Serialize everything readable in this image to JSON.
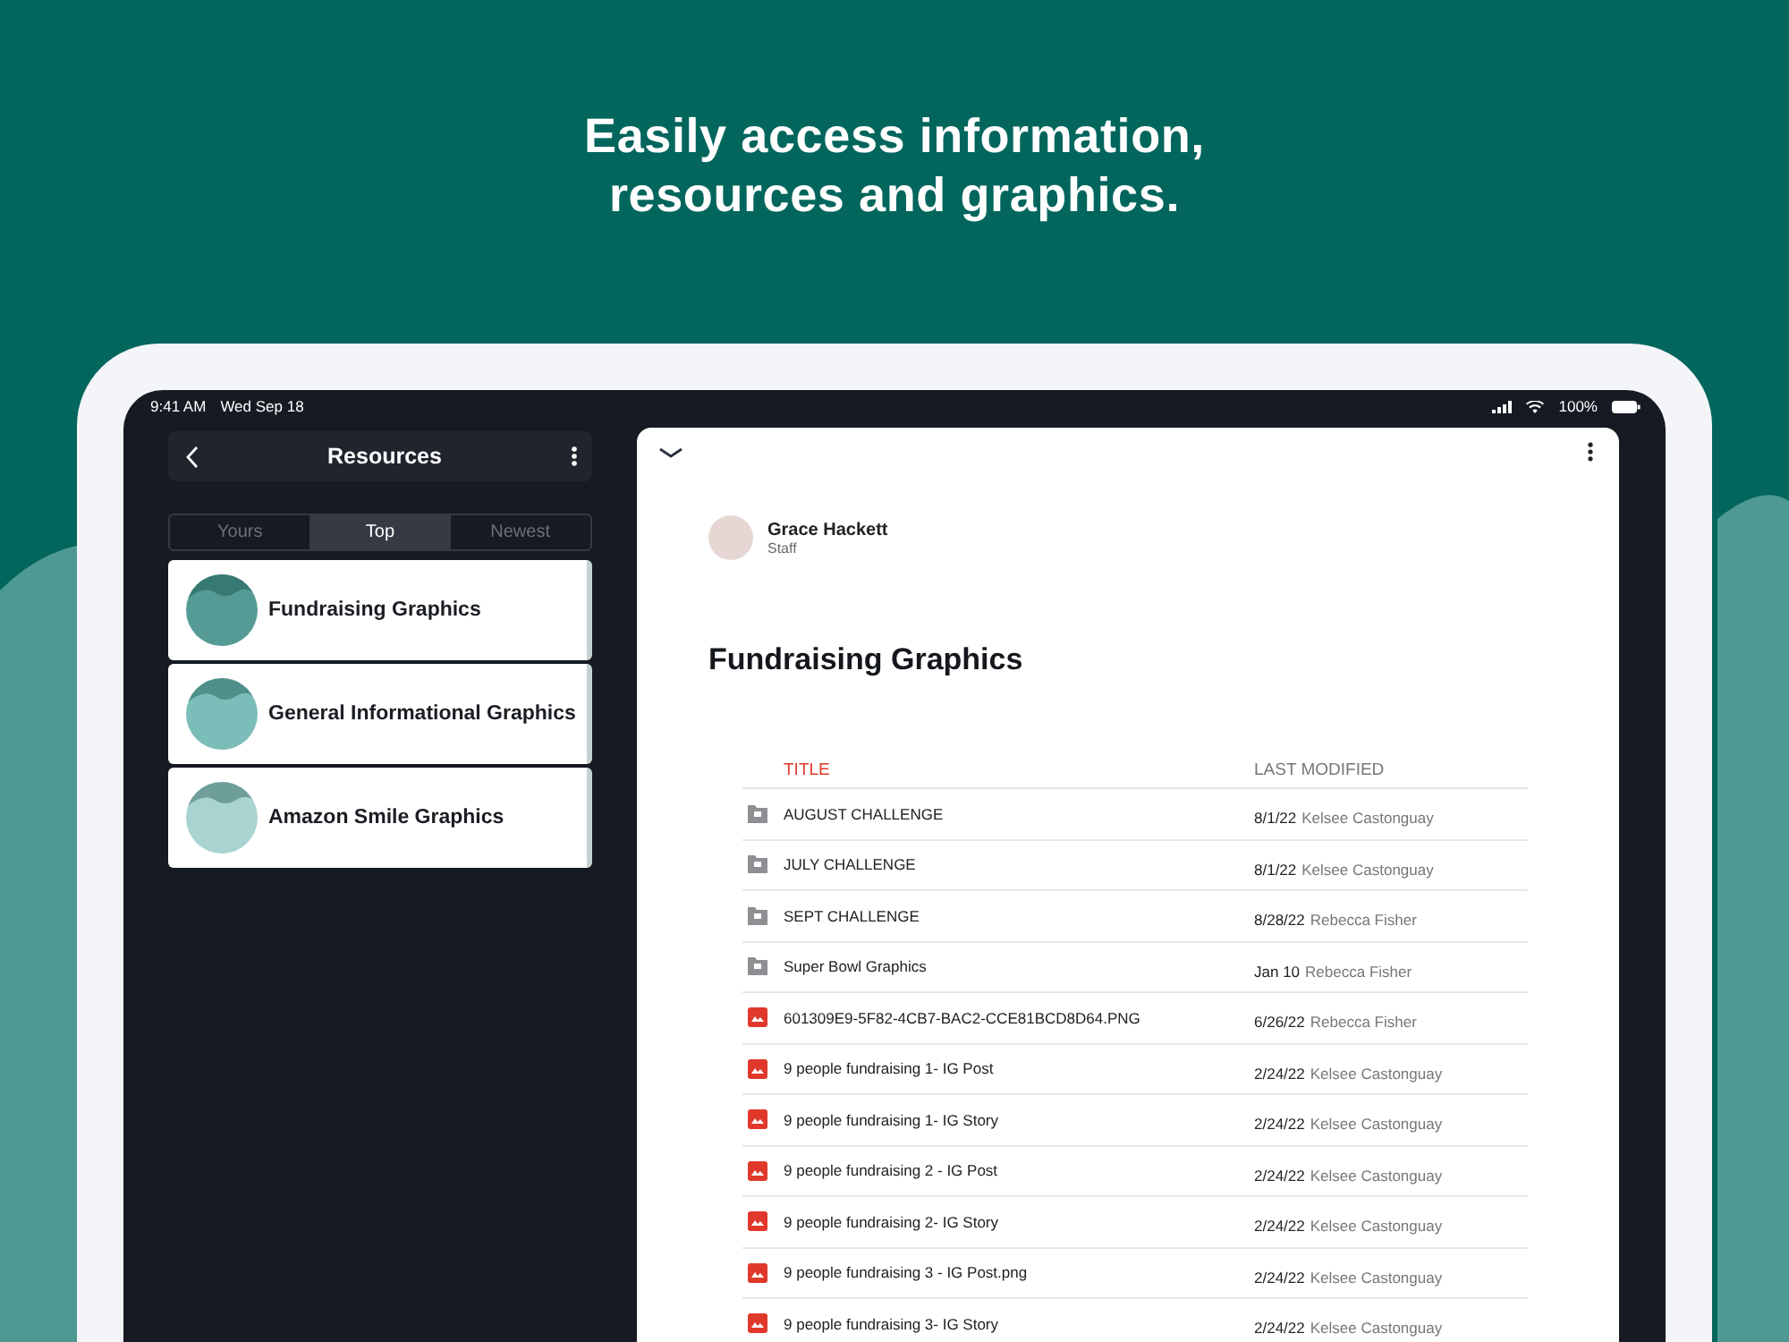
{
  "headline": [
    "Easily access information,",
    "resources and graphics."
  ],
  "status_bar": {
    "time": "9:41 AM",
    "date": "Wed Sep 18",
    "battery": "100%"
  },
  "sidebar": {
    "title": "Resources",
    "tabs": [
      {
        "label": "Yours",
        "selected": false
      },
      {
        "label": "Top",
        "selected": true
      },
      {
        "label": "Newest",
        "selected": false
      }
    ],
    "items": [
      {
        "label": "Fundraising Graphics",
        "color": "#559a94"
      },
      {
        "label": "General Informational Graphics",
        "color": "#7bbdb8"
      },
      {
        "label": "Amazon Smile Graphics",
        "color": "#a8d3d0"
      }
    ]
  },
  "detail": {
    "author": {
      "name": "Grace Hackett",
      "role": "Staff"
    },
    "title": "Fundraising Graphics",
    "table": {
      "columns": [
        "TITLE",
        "LAST MODIFIED"
      ],
      "rows": [
        {
          "kind": "folder",
          "title": "AUGUST CHALLENGE",
          "date": "8/1/22",
          "person": "Kelsee Castonguay"
        },
        {
          "kind": "folder",
          "title": "JULY CHALLENGE",
          "date": "8/1/22",
          "person": "Kelsee Castonguay"
        },
        {
          "kind": "folder",
          "title": "SEPT CHALLENGE",
          "date": "8/28/22",
          "person": "Rebecca Fisher"
        },
        {
          "kind": "folder",
          "title": "Super Bowl Graphics",
          "date": "Jan 10",
          "person": "Rebecca Fisher"
        },
        {
          "kind": "image",
          "title": "601309E9-5F82-4CB7-BAC2-CCE81BCD8D64.PNG",
          "date": "6/26/22",
          "person": "Rebecca Fisher"
        },
        {
          "kind": "image",
          "title": "9 people fundraising 1- IG Post",
          "date": "2/24/22",
          "person": "Kelsee Castonguay"
        },
        {
          "kind": "image",
          "title": "9 people fundraising 1- IG Story",
          "date": "2/24/22",
          "person": "Kelsee Castonguay"
        },
        {
          "kind": "image",
          "title": "9 people fundraising 2 - IG Post",
          "date": "2/24/22",
          "person": "Kelsee Castonguay"
        },
        {
          "kind": "image",
          "title": "9 people fundraising 2- IG Story",
          "date": "2/24/22",
          "person": "Kelsee Castonguay"
        },
        {
          "kind": "image",
          "title": "9 people fundraising 3 - IG Post.png",
          "date": "2/24/22",
          "person": "Kelsee Castonguay"
        },
        {
          "kind": "image",
          "title": "9 people fundraising 3- IG Story",
          "date": "2/24/22",
          "person": "Kelsee Castonguay"
        }
      ]
    }
  }
}
